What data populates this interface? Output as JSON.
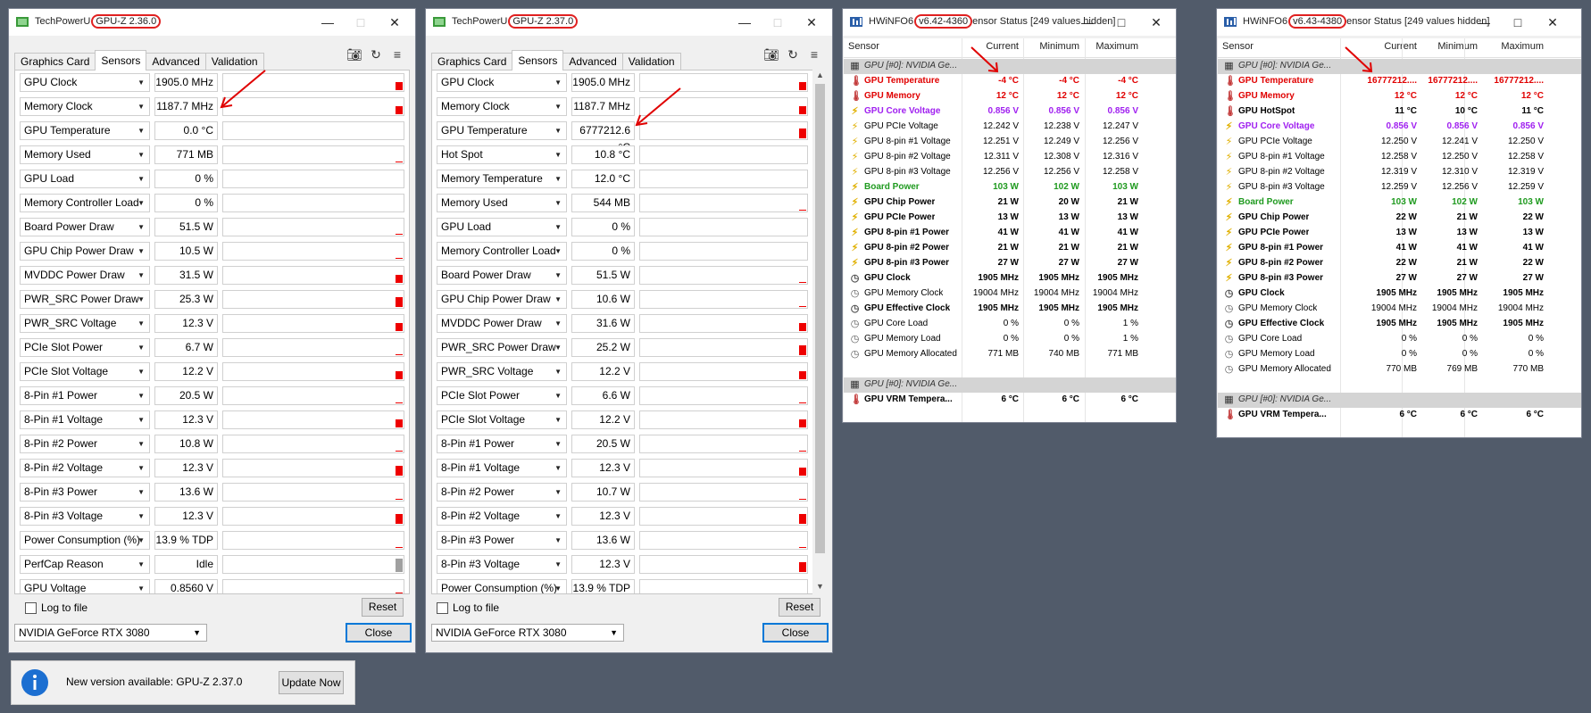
{
  "gpuz1": {
    "title_prefix": "TechPowerU",
    "title_version": "GPU-Z 2.36.0",
    "tabs": [
      "Graphics Card",
      "Sensors",
      "Advanced",
      "Validation"
    ],
    "sensors": [
      {
        "name": "GPU Clock",
        "value": "1905.0 MHz",
        "bar": 0.45
      },
      {
        "name": "Memory Clock",
        "value": "1187.7 MHz",
        "bar": 0.45
      },
      {
        "name": "GPU Temperature",
        "value": "0.0 °C",
        "bar": 0
      },
      {
        "name": "Memory Used",
        "value": "771 MB",
        "bar": 0.05
      },
      {
        "name": "GPU Load",
        "value": "0 %",
        "bar": 0
      },
      {
        "name": "Memory Controller Load",
        "value": "0 %",
        "bar": 0
      },
      {
        "name": "Board Power Draw",
        "value": "51.5 W",
        "bar": 0.05
      },
      {
        "name": "GPU Chip Power Draw",
        "value": "10.5 W",
        "bar": 0.05
      },
      {
        "name": "MVDDC Power Draw",
        "value": "31.5 W",
        "bar": 0.45
      },
      {
        "name": "PWR_SRC Power Draw",
        "value": "25.3 W",
        "bar": 0.6
      },
      {
        "name": "PWR_SRC Voltage",
        "value": "12.3 V",
        "bar": 0.5
      },
      {
        "name": "PCIe Slot Power",
        "value": "6.7 W",
        "bar": 0.05
      },
      {
        "name": "PCIe Slot Voltage",
        "value": "12.2 V",
        "bar": 0.5
      },
      {
        "name": "8-Pin #1 Power",
        "value": "20.5 W",
        "bar": 0.05
      },
      {
        "name": "8-Pin #1 Voltage",
        "value": "12.3 V",
        "bar": 0.5
      },
      {
        "name": "8-Pin #2 Power",
        "value": "10.8 W",
        "bar": 0.05
      },
      {
        "name": "8-Pin #2 Voltage",
        "value": "12.3 V",
        "bar": 0.6
      },
      {
        "name": "8-Pin #3 Power",
        "value": "13.6 W",
        "bar": 0.05
      },
      {
        "name": "8-Pin #3 Voltage",
        "value": "12.3 V",
        "bar": 0.6
      },
      {
        "name": "Power Consumption (%)",
        "value": "13.9 % TDP",
        "bar": 0.05
      },
      {
        "name": "PerfCap Reason",
        "value": "Idle",
        "bar": 0.8,
        "grey": true
      },
      {
        "name": "GPU Voltage",
        "value": "0.8560 V",
        "bar": 0.2
      }
    ],
    "log_label": "Log to file",
    "reset_label": "Reset",
    "gpu_select": "NVIDIA GeForce RTX 3080",
    "close_label": "Close"
  },
  "gpuz2": {
    "title_prefix": "TechPowerU",
    "title_version": "GPU-Z 2.37.0",
    "tabs": [
      "Graphics Card",
      "Sensors",
      "Advanced",
      "Validation"
    ],
    "sensors": [
      {
        "name": "GPU Clock",
        "value": "1905.0 MHz",
        "bar": 0.45
      },
      {
        "name": "Memory Clock",
        "value": "1187.7 MHz",
        "bar": 0.45
      },
      {
        "name": "GPU Temperature",
        "value": "6777212.6 °C",
        "bar": 0.6
      },
      {
        "name": "Hot Spot",
        "value": "10.8 °C",
        "bar": 0
      },
      {
        "name": "Memory Temperature",
        "value": "12.0 °C",
        "bar": 0
      },
      {
        "name": "Memory Used",
        "value": "544 MB",
        "bar": 0.05
      },
      {
        "name": "GPU Load",
        "value": "0 %",
        "bar": 0
      },
      {
        "name": "Memory Controller Load",
        "value": "0 %",
        "bar": 0
      },
      {
        "name": "Board Power Draw",
        "value": "51.5 W",
        "bar": 0.05
      },
      {
        "name": "GPU Chip Power Draw",
        "value": "10.6 W",
        "bar": 0.05
      },
      {
        "name": "MVDDC Power Draw",
        "value": "31.6 W",
        "bar": 0.45
      },
      {
        "name": "PWR_SRC Power Draw",
        "value": "25.2 W",
        "bar": 0.6
      },
      {
        "name": "PWR_SRC Voltage",
        "value": "12.2 V",
        "bar": 0.5
      },
      {
        "name": "PCIe Slot Power",
        "value": "6.6 W",
        "bar": 0.05
      },
      {
        "name": "PCIe Slot Voltage",
        "value": "12.2 V",
        "bar": 0.5
      },
      {
        "name": "8-Pin #1 Power",
        "value": "20.5 W",
        "bar": 0.05
      },
      {
        "name": "8-Pin #1 Voltage",
        "value": "12.3 V",
        "bar": 0.5
      },
      {
        "name": "8-Pin #2 Power",
        "value": "10.7 W",
        "bar": 0.05
      },
      {
        "name": "8-Pin #2 Voltage",
        "value": "12.3 V",
        "bar": 0.6
      },
      {
        "name": "8-Pin #3 Power",
        "value": "13.6 W",
        "bar": 0.05
      },
      {
        "name": "8-Pin #3 Voltage",
        "value": "12.3 V",
        "bar": 0.6
      },
      {
        "name": "Power Consumption (%)",
        "value": "13.9 % TDP",
        "bar": 0.05
      }
    ],
    "log_label": "Log to file",
    "reset_label": "Reset",
    "gpu_select": "NVIDIA GeForce RTX 3080",
    "close_label": "Close"
  },
  "hw1": {
    "title_prefix": "HWiNFO6",
    "title_version": "v6.42-4360",
    "title_suffix": "ensor Status [249 values hidden]",
    "columns": [
      "Sensor",
      "Current",
      "Minimum",
      "Maximum"
    ],
    "rows": [
      {
        "type": "group",
        "name": "GPU [#0]: NVIDIA Ge..."
      },
      {
        "icon": "temp",
        "name": "GPU Temperature",
        "cur": "-4 °C",
        "min": "-4 °C",
        "max": "-4 °C",
        "style": "red"
      },
      {
        "icon": "temp",
        "name": "GPU Memory",
        "cur": "12 °C",
        "min": "12 °C",
        "max": "12 °C",
        "style": "red"
      },
      {
        "icon": "volt",
        "name": "GPU Core Voltage",
        "cur": "0.856 V",
        "min": "0.856 V",
        "max": "0.856 V",
        "style": "purple"
      },
      {
        "icon": "volt",
        "name": "GPU PCIe Voltage",
        "cur": "12.242 V",
        "min": "12.238 V",
        "max": "12.247 V"
      },
      {
        "icon": "volt",
        "name": "GPU 8-pin #1 Voltage",
        "cur": "12.251 V",
        "min": "12.249 V",
        "max": "12.256 V"
      },
      {
        "icon": "volt",
        "name": "GPU 8-pin #2 Voltage",
        "cur": "12.311 V",
        "min": "12.308 V",
        "max": "12.316 V"
      },
      {
        "icon": "volt",
        "name": "GPU 8-pin #3 Voltage",
        "cur": "12.256 V",
        "min": "12.256 V",
        "max": "12.258 V"
      },
      {
        "icon": "volt",
        "name": "Board Power",
        "cur": "103 W",
        "min": "102 W",
        "max": "103 W",
        "style": "green"
      },
      {
        "icon": "volt",
        "name": "GPU Chip Power",
        "cur": "21 W",
        "min": "20 W",
        "max": "21 W",
        "style": "bold"
      },
      {
        "icon": "volt",
        "name": "GPU PCIe Power",
        "cur": "13 W",
        "min": "13 W",
        "max": "13 W",
        "style": "bold"
      },
      {
        "icon": "volt",
        "name": "GPU 8-pin #1 Power",
        "cur": "41 W",
        "min": "41 W",
        "max": "41 W",
        "style": "bold"
      },
      {
        "icon": "volt",
        "name": "GPU 8-pin #2 Power",
        "cur": "21 W",
        "min": "21 W",
        "max": "21 W",
        "style": "bold"
      },
      {
        "icon": "volt",
        "name": "GPU 8-pin #3 Power",
        "cur": "27 W",
        "min": "27 W",
        "max": "27 W",
        "style": "bold"
      },
      {
        "icon": "clock",
        "name": "GPU Clock",
        "cur": "1905 MHz",
        "min": "1905 MHz",
        "max": "1905 MHz",
        "style": "bold"
      },
      {
        "icon": "clock",
        "name": "GPU Memory Clock",
        "cur": "19004 MHz",
        "min": "19004 MHz",
        "max": "19004 MHz"
      },
      {
        "icon": "clock",
        "name": "GPU Effective Clock",
        "cur": "1905 MHz",
        "min": "1905 MHz",
        "max": "1905 MHz",
        "style": "bold"
      },
      {
        "icon": "clock",
        "name": "GPU Core Load",
        "cur": "0 %",
        "min": "0 %",
        "max": "1 %"
      },
      {
        "icon": "clock",
        "name": "GPU Memory Load",
        "cur": "0 %",
        "min": "0 %",
        "max": "1 %"
      },
      {
        "icon": "clock",
        "name": "GPU Memory Allocated",
        "cur": "771 MB",
        "min": "740 MB",
        "max": "771 MB"
      },
      {
        "type": "blank"
      },
      {
        "type": "group",
        "name": "GPU [#0]: NVIDIA Ge..."
      },
      {
        "icon": "temp",
        "name": "GPU VRM Tempera...",
        "cur": "6 °C",
        "min": "6 °C",
        "max": "6 °C",
        "style": "bold"
      }
    ]
  },
  "hw2": {
    "title_prefix": "HWiNFO6",
    "title_version": "v6.43-4380",
    "title_suffix": "ensor Status [249 values hidden]",
    "columns": [
      "Sensor",
      "Current",
      "Minimum",
      "Maximum"
    ],
    "rows": [
      {
        "type": "group",
        "name": "GPU [#0]: NVIDIA Ge..."
      },
      {
        "icon": "temp",
        "name": "GPU Temperature",
        "cur": "16777212....",
        "min": "16777212....",
        "max": "16777212....",
        "style": "red"
      },
      {
        "icon": "temp",
        "name": "GPU Memory",
        "cur": "12 °C",
        "min": "12 °C",
        "max": "12 °C",
        "style": "red"
      },
      {
        "icon": "temp",
        "name": "GPU HotSpot",
        "cur": "11 °C",
        "min": "10 °C",
        "max": "11 °C",
        "style": "bold"
      },
      {
        "icon": "volt",
        "name": "GPU Core Voltage",
        "cur": "0.856 V",
        "min": "0.856 V",
        "max": "0.856 V",
        "style": "purple"
      },
      {
        "icon": "volt",
        "name": "GPU PCIe Voltage",
        "cur": "12.250 V",
        "min": "12.241 V",
        "max": "12.250 V"
      },
      {
        "icon": "volt",
        "name": "GPU 8-pin #1 Voltage",
        "cur": "12.258 V",
        "min": "12.250 V",
        "max": "12.258 V"
      },
      {
        "icon": "volt",
        "name": "GPU 8-pin #2 Voltage",
        "cur": "12.319 V",
        "min": "12.310 V",
        "max": "12.319 V"
      },
      {
        "icon": "volt",
        "name": "GPU 8-pin #3 Voltage",
        "cur": "12.259 V",
        "min": "12.256 V",
        "max": "12.259 V"
      },
      {
        "icon": "volt",
        "name": "Board Power",
        "cur": "103 W",
        "min": "102 W",
        "max": "103 W",
        "style": "green"
      },
      {
        "icon": "volt",
        "name": "GPU Chip Power",
        "cur": "22 W",
        "min": "21 W",
        "max": "22 W",
        "style": "bold"
      },
      {
        "icon": "volt",
        "name": "GPU PCIe Power",
        "cur": "13 W",
        "min": "13 W",
        "max": "13 W",
        "style": "bold"
      },
      {
        "icon": "volt",
        "name": "GPU 8-pin #1 Power",
        "cur": "41 W",
        "min": "41 W",
        "max": "41 W",
        "style": "bold"
      },
      {
        "icon": "volt",
        "name": "GPU 8-pin #2 Power",
        "cur": "22 W",
        "min": "21 W",
        "max": "22 W",
        "style": "bold"
      },
      {
        "icon": "volt",
        "name": "GPU 8-pin #3 Power",
        "cur": "27 W",
        "min": "27 W",
        "max": "27 W",
        "style": "bold"
      },
      {
        "icon": "clock",
        "name": "GPU Clock",
        "cur": "1905 MHz",
        "min": "1905 MHz",
        "max": "1905 MHz",
        "style": "bold"
      },
      {
        "icon": "clock",
        "name": "GPU Memory Clock",
        "cur": "19004 MHz",
        "min": "19004 MHz",
        "max": "19004 MHz"
      },
      {
        "icon": "clock",
        "name": "GPU Effective Clock",
        "cur": "1905 MHz",
        "min": "1905 MHz",
        "max": "1905 MHz",
        "style": "bold"
      },
      {
        "icon": "clock",
        "name": "GPU Core Load",
        "cur": "0 %",
        "min": "0 %",
        "max": "0 %"
      },
      {
        "icon": "clock",
        "name": "GPU Memory Load",
        "cur": "0 %",
        "min": "0 %",
        "max": "0 %"
      },
      {
        "icon": "clock",
        "name": "GPU Memory Allocated",
        "cur": "770 MB",
        "min": "769 MB",
        "max": "770 MB"
      },
      {
        "type": "blank"
      },
      {
        "type": "group",
        "name": "GPU [#0]: NVIDIA Ge..."
      },
      {
        "icon": "temp",
        "name": "GPU VRM Tempera...",
        "cur": "6 °C",
        "min": "6 °C",
        "max": "6 °C",
        "style": "bold"
      }
    ]
  },
  "notification": {
    "message": "New version available: GPU-Z 2.37.0",
    "button": "Update Now"
  },
  "colors": {
    "desktop": "#515b6a",
    "highlight": "#e02020",
    "bar": "#ee0000"
  }
}
